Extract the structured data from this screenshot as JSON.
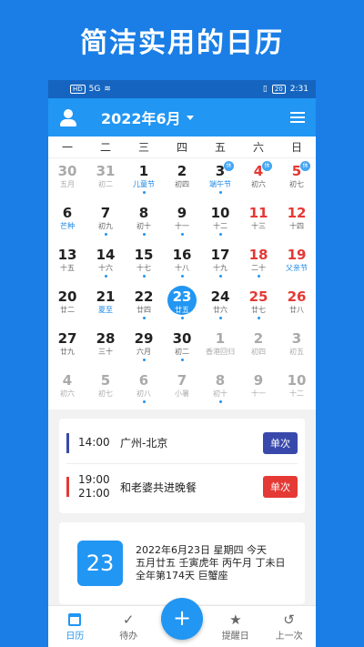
{
  "banner": "简洁实用的日历",
  "status": {
    "left": "HD",
    "signal": "5G",
    "battery": "20",
    "time": "2:31"
  },
  "header": {
    "title": "2022年6月"
  },
  "weekdays": [
    "一",
    "二",
    "三",
    "四",
    "五",
    "六",
    "日"
  ],
  "days": [
    {
      "n": "30",
      "s": "五月",
      "faded": true
    },
    {
      "n": "31",
      "s": "初二",
      "faded": true
    },
    {
      "n": "1",
      "s": "儿童节",
      "blue": true,
      "dot": true
    },
    {
      "n": "2",
      "s": "初四"
    },
    {
      "n": "3",
      "s": "端午节",
      "blue": true,
      "badge": "休",
      "dot": true
    },
    {
      "n": "4",
      "s": "初六",
      "red": true,
      "badge": "休"
    },
    {
      "n": "5",
      "s": "初七",
      "red": true,
      "badge": "休"
    },
    {
      "n": "6",
      "s": "芒种",
      "blue": true
    },
    {
      "n": "7",
      "s": "初九",
      "dot": true
    },
    {
      "n": "8",
      "s": "初十",
      "dot": true
    },
    {
      "n": "9",
      "s": "十一",
      "dot": true
    },
    {
      "n": "10",
      "s": "十二",
      "dot": true
    },
    {
      "n": "11",
      "s": "十三",
      "red": true
    },
    {
      "n": "12",
      "s": "十四",
      "red": true
    },
    {
      "n": "13",
      "s": "十五"
    },
    {
      "n": "14",
      "s": "十六",
      "dot": true
    },
    {
      "n": "15",
      "s": "十七",
      "dot": true
    },
    {
      "n": "16",
      "s": "十八",
      "dot": true
    },
    {
      "n": "17",
      "s": "十九",
      "dot": true
    },
    {
      "n": "18",
      "s": "二十",
      "red": true,
      "dot": true
    },
    {
      "n": "19",
      "s": "父亲节",
      "red": true,
      "blue": true
    },
    {
      "n": "20",
      "s": "廿二"
    },
    {
      "n": "21",
      "s": "夏至",
      "blue": true
    },
    {
      "n": "22",
      "s": "廿四",
      "dot": true
    },
    {
      "n": "23",
      "s": "廿五",
      "today": true,
      "dot": true
    },
    {
      "n": "24",
      "s": "廿六",
      "dot": true
    },
    {
      "n": "25",
      "s": "廿七",
      "red": true,
      "dot": true
    },
    {
      "n": "26",
      "s": "廿八",
      "red": true
    },
    {
      "n": "27",
      "s": "廿九"
    },
    {
      "n": "28",
      "s": "三十"
    },
    {
      "n": "29",
      "s": "六月",
      "dot": true
    },
    {
      "n": "30",
      "s": "初二",
      "dot": true
    },
    {
      "n": "1",
      "s": "香港回归",
      "faded": true
    },
    {
      "n": "2",
      "s": "初四",
      "faded": true
    },
    {
      "n": "3",
      "s": "初五",
      "faded": true
    },
    {
      "n": "4",
      "s": "初六",
      "faded": true
    },
    {
      "n": "5",
      "s": "初七",
      "faded": true
    },
    {
      "n": "6",
      "s": "初八",
      "faded": true,
      "dot": true
    },
    {
      "n": "7",
      "s": "小暑",
      "faded": true
    },
    {
      "n": "8",
      "s": "初十",
      "faded": true,
      "dot": true
    },
    {
      "n": "9",
      "s": "十一",
      "faded": true
    },
    {
      "n": "10",
      "s": "十二",
      "faded": true
    }
  ],
  "events": [
    {
      "time1": "14:00",
      "time2": "",
      "title": "广州-北京",
      "tag": "单次",
      "bar_color": "#3949ab",
      "tag_color": "#3949ab"
    },
    {
      "time1": "19:00",
      "time2": "21:00",
      "title": "和老婆共进晚餐",
      "tag": "单次",
      "bar_color": "#e53935",
      "tag_color": "#e53935"
    }
  ],
  "info": {
    "day": "23",
    "line1": "2022年6月23日 星期四 今天",
    "line2": "五月廿五 壬寅虎年 丙午月 丁未日",
    "line3": "全年第174天 巨蟹座"
  },
  "nav": {
    "calendar": "日历",
    "todo": "待办",
    "reminder": "提醒日",
    "previous": "上一次",
    "fab": "+"
  }
}
